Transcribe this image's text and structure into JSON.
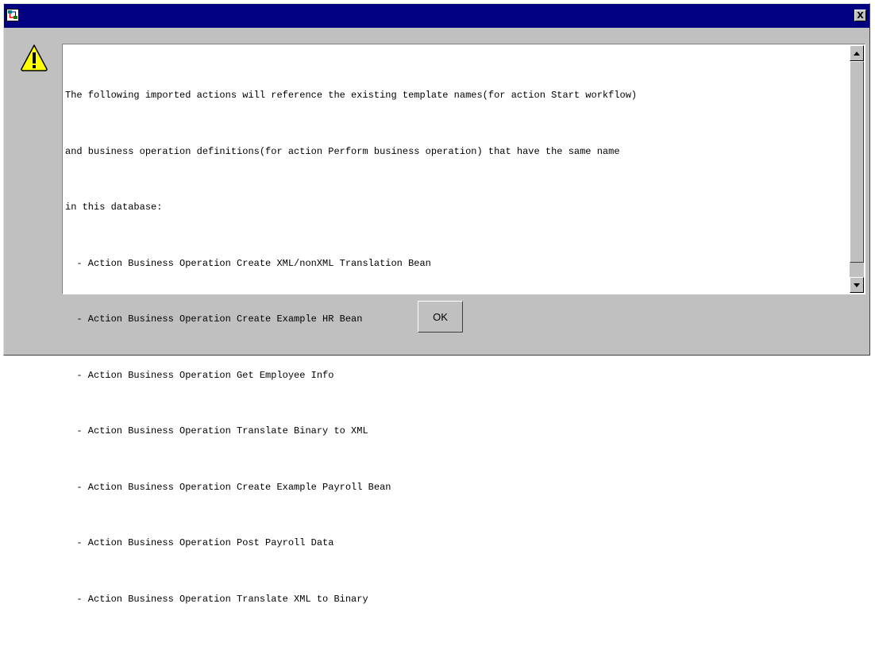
{
  "window": {
    "title": "",
    "title_bar_color": "#000080",
    "background_color": "#c0c0c0",
    "icons": {
      "app": "app-icon",
      "close": "close-icon",
      "warning": "warning-icon"
    },
    "close_label": "X"
  },
  "message": {
    "lines": [
      "The following imported actions will reference the existing template names(for action Start workflow)",
      "and business operation definitions(for action Perform business operation) that have the same name",
      "in this database:",
      "  - Action Business Operation Create XML/nonXML Translation Bean",
      "  - Action Business Operation Create Example HR Bean",
      "  - Action Business Operation Get Employee Info",
      "  - Action Business Operation Translate Binary to XML",
      "  - Action Business Operation Create Example Payroll Bean",
      "  - Action Business Operation Post Payroll Data",
      "  - Action Business Operation Translate XML to Binary"
    ]
  },
  "buttons": {
    "ok_label": "OK"
  }
}
